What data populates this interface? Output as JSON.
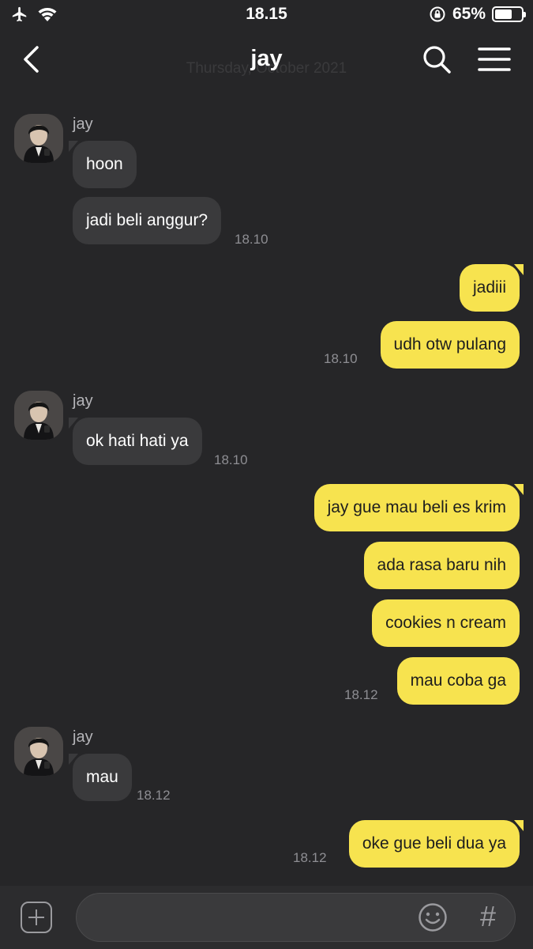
{
  "status_bar": {
    "time": "18.15",
    "battery_percent": "65%",
    "battery_level": 0.65,
    "icons": [
      "airplane-icon",
      "wifi-icon",
      "orientation-lock-icon",
      "battery-icon"
    ]
  },
  "header": {
    "title": "jay",
    "date_ghost": "Thursday,   October 2021",
    "icons": [
      "back-icon",
      "search-icon",
      "menu-icon"
    ]
  },
  "messages": [
    {
      "sender": "jay",
      "text": "hoon",
      "direction": "in"
    },
    {
      "text": "jadi beli anggur?",
      "time": "18.10",
      "direction": "in"
    },
    {
      "text": "jadiii",
      "direction": "out"
    },
    {
      "text": "udh otw pulang",
      "time": "18.10",
      "direction": "out"
    },
    {
      "sender": "jay",
      "text": "ok hati hati ya",
      "time": "18.10",
      "direction": "in"
    },
    {
      "text": "jay gue mau beli es krim",
      "direction": "out"
    },
    {
      "text": "ada rasa baru nih",
      "direction": "out"
    },
    {
      "text": "cookies n cream",
      "direction": "out"
    },
    {
      "text": "mau coba ga",
      "time": "18.12",
      "direction": "out"
    },
    {
      "sender": "jay",
      "text": "mau",
      "time": "18.12",
      "direction": "in"
    },
    {
      "text": "oke gue beli dua ya",
      "time": "18.12",
      "direction": "out"
    }
  ],
  "input_bar": {
    "placeholder": "",
    "hash_label": "#",
    "icons": [
      "plus-icon",
      "emoji-icon",
      "hash-icon"
    ]
  },
  "colors": {
    "background": "#262628",
    "incoming_bubble": "#3a3a3c",
    "outgoing_bubble": "#f7e34f",
    "timestamp": "#8e8e93"
  }
}
